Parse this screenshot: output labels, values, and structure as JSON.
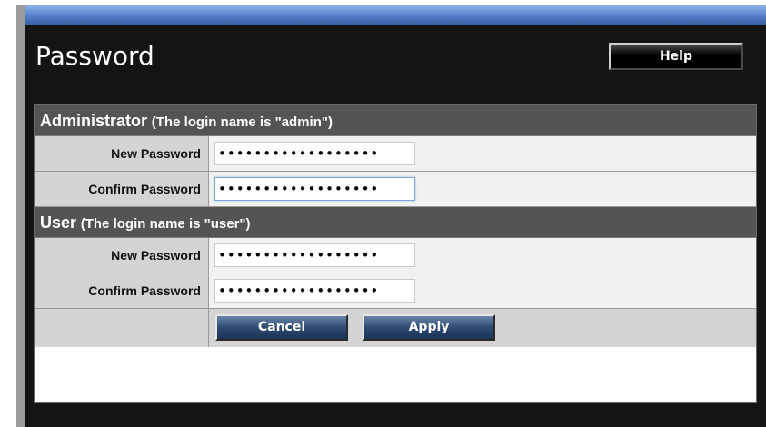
{
  "page": {
    "title": "Password",
    "help_label": "Help"
  },
  "administrator": {
    "heading": "Administrator",
    "note": "(The login name is \"admin\")",
    "new_password_label": "New Password",
    "new_password_value": "••••••••••••••••••",
    "confirm_password_label": "Confirm Password",
    "confirm_password_value": "••••••••••••••••••"
  },
  "user": {
    "heading": "User",
    "note": "(The login name is \"user\")",
    "new_password_label": "New Password",
    "new_password_value": "••••••••••••••••••",
    "confirm_password_label": "Confirm Password",
    "confirm_password_value": "••••••••••••••••••"
  },
  "actions": {
    "cancel_label": "Cancel",
    "apply_label": "Apply"
  },
  "colors": {
    "top_bar": "#4d79c4",
    "panel_background": "#141414",
    "section_header": "#545454",
    "label_cell": "#d4d4d4",
    "value_cell": "#f1f1f1",
    "action_button": "#2c4a74"
  }
}
